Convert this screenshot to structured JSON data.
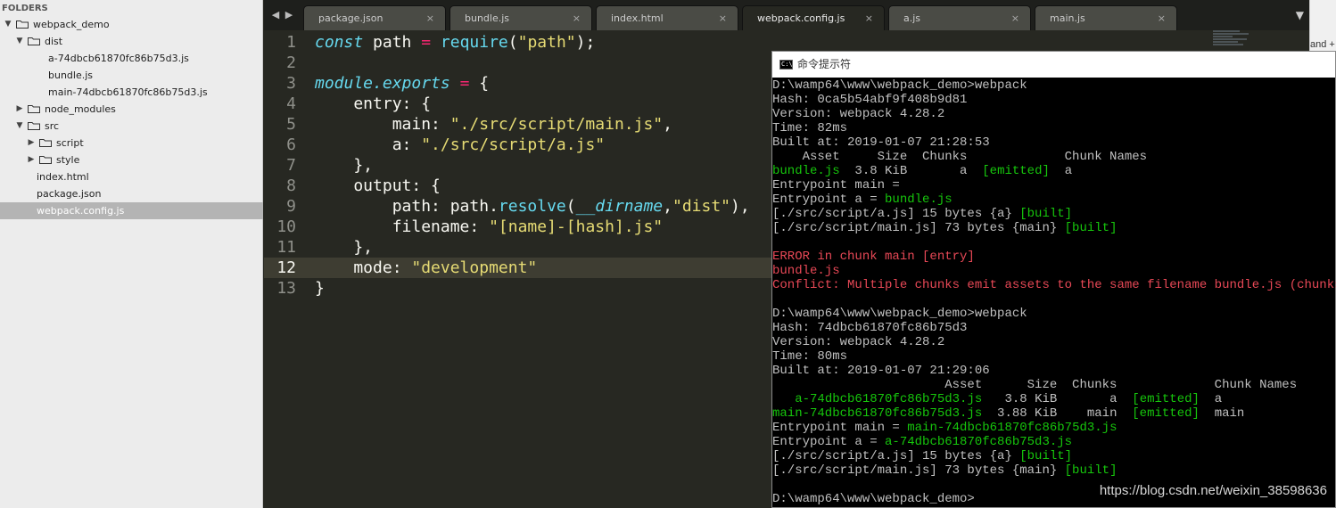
{
  "sidebar": {
    "header": "FOLDERS",
    "items": [
      {
        "label": "webpack_demo",
        "type": "folder",
        "arrow": "▼",
        "level": 0,
        "name": "tree-folder-webpack-demo"
      },
      {
        "label": "dist",
        "type": "folder",
        "arrow": "▼",
        "level": 1,
        "name": "tree-folder-dist"
      },
      {
        "label": "a-74dbcb61870fc86b75d3.js",
        "type": "file",
        "level": 3,
        "name": "tree-file-a-hash"
      },
      {
        "label": "bundle.js",
        "type": "file",
        "level": 3,
        "name": "tree-file-bundle"
      },
      {
        "label": "main-74dbcb61870fc86b75d3.js",
        "type": "file",
        "level": 3,
        "name": "tree-file-main-hash"
      },
      {
        "label": "node_modules",
        "type": "folder",
        "arrow": "▶",
        "level": 1,
        "name": "tree-folder-node-modules"
      },
      {
        "label": "src",
        "type": "folder",
        "arrow": "▼",
        "level": 1,
        "name": "tree-folder-src"
      },
      {
        "label": "script",
        "type": "folder",
        "arrow": "▶",
        "level": 2,
        "name": "tree-folder-script"
      },
      {
        "label": "style",
        "type": "folder",
        "arrow": "▶",
        "level": 2,
        "name": "tree-folder-style"
      },
      {
        "label": "index.html",
        "type": "file",
        "level": 2,
        "name": "tree-file-index-html"
      },
      {
        "label": "package.json",
        "type": "file",
        "level": 2,
        "name": "tree-file-package-json"
      },
      {
        "label": "webpack.config.js",
        "type": "file",
        "level": 2,
        "selected": true,
        "name": "tree-file-webpack-config"
      }
    ]
  },
  "tabs": [
    {
      "label": "package.json",
      "active": false
    },
    {
      "label": "bundle.js",
      "active": false
    },
    {
      "label": "index.html",
      "active": false
    },
    {
      "label": "webpack.config.js",
      "active": true
    },
    {
      "label": "a.js",
      "active": false
    },
    {
      "label": "main.js",
      "active": false
    }
  ],
  "tab_close_glyph": "×",
  "nav": {
    "prev": "◀",
    "next": "▶",
    "dropdown": "▼"
  },
  "editor": {
    "current_line": 12,
    "lines": [
      [
        [
          "kw",
          "const"
        ],
        [
          "t",
          " path "
        ],
        [
          "op",
          "="
        ],
        [
          "t",
          " "
        ],
        [
          "fn",
          "require"
        ],
        [
          "t",
          "("
        ],
        [
          "str",
          "\"path\""
        ],
        [
          "t",
          ");"
        ]
      ],
      [],
      [
        [
          "it",
          "module"
        ],
        [
          "it",
          "."
        ],
        [
          "it",
          "exports"
        ],
        [
          "t",
          " "
        ],
        [
          "op",
          "="
        ],
        [
          "t",
          " {"
        ]
      ],
      [
        [
          "t",
          "    entry: {"
        ]
      ],
      [
        [
          "t",
          "        main: "
        ],
        [
          "str",
          "\"./src/script/main.js\""
        ],
        [
          "t",
          ","
        ]
      ],
      [
        [
          "t",
          "        a: "
        ],
        [
          "str",
          "\"./src/script/a.js\""
        ]
      ],
      [
        [
          "t",
          "    },"
        ]
      ],
      [
        [
          "t",
          "    output: {"
        ]
      ],
      [
        [
          "t",
          "        path: path."
        ],
        [
          "fn",
          "resolve"
        ],
        [
          "t",
          "("
        ],
        [
          "it",
          "__dirname"
        ],
        [
          "t",
          ","
        ],
        [
          "str",
          "\"dist\""
        ],
        [
          "t",
          "),"
        ]
      ],
      [
        [
          "t",
          "        filename: "
        ],
        [
          "str",
          "\"[name]-[hash].js\""
        ]
      ],
      [
        [
          "t",
          "    },"
        ]
      ],
      [
        [
          "t",
          "    mode: "
        ],
        [
          "str",
          "\"development\""
        ]
      ],
      [
        [
          "t",
          "}"
        ]
      ]
    ]
  },
  "right_sliver_text": "and +",
  "cmd": {
    "title": "命令提示符",
    "icon_text": "C:\\",
    "lines": [
      [
        [
          "w",
          "D:\\wamp64\\www\\webpack_demo>webpack"
        ]
      ],
      [
        [
          "w",
          "Hash: 0ca5b54abf9f408b9d81"
        ]
      ],
      [
        [
          "w",
          "Version: webpack 4.28.2"
        ]
      ],
      [
        [
          "w",
          "Time: 82ms"
        ]
      ],
      [
        [
          "w",
          "Built at: 2019-01-07 21:28:53"
        ]
      ],
      [
        [
          "w",
          "    Asset     Size  Chunks             Chunk Names"
        ]
      ],
      [
        [
          "g",
          "bundle.js"
        ],
        [
          "w",
          "  3.8 KiB       a  "
        ],
        [
          "g",
          "[emitted]"
        ],
        [
          "w",
          "  a"
        ]
      ],
      [
        [
          "w",
          "Entrypoint main ="
        ]
      ],
      [
        [
          "w",
          "Entrypoint a = "
        ],
        [
          "g",
          "bundle.js"
        ]
      ],
      [
        [
          "w",
          "[./src/script/a.js] 15 bytes {a} "
        ],
        [
          "g",
          "[built]"
        ]
      ],
      [
        [
          "w",
          "[./src/script/main.js] 73 bytes {main} "
        ],
        [
          "g",
          "[built]"
        ]
      ],
      [],
      [
        [
          "r",
          "ERROR in chunk main [entry]"
        ]
      ],
      [
        [
          "r",
          "bundle.js"
        ]
      ],
      [
        [
          "r",
          "Conflict: Multiple chunks emit assets to the same filename bundle.js (chunks a"
        ]
      ],
      [],
      [
        [
          "w",
          "D:\\wamp64\\www\\webpack_demo>webpack"
        ]
      ],
      [
        [
          "w",
          "Hash: 74dbcb61870fc86b75d3"
        ]
      ],
      [
        [
          "w",
          "Version: webpack 4.28.2"
        ]
      ],
      [
        [
          "w",
          "Time: 80ms"
        ]
      ],
      [
        [
          "w",
          "Built at: 2019-01-07 21:29:06"
        ]
      ],
      [
        [
          "w",
          "                       Asset      Size  Chunks             Chunk Names"
        ]
      ],
      [
        [
          "w",
          "   "
        ],
        [
          "g",
          "a-74dbcb61870fc86b75d3.js"
        ],
        [
          "w",
          "   3.8 KiB       a  "
        ],
        [
          "g",
          "[emitted]"
        ],
        [
          "w",
          "  a"
        ]
      ],
      [
        [
          "g",
          "main-74dbcb61870fc86b75d3.js"
        ],
        [
          "w",
          "  3.88 KiB    main  "
        ],
        [
          "g",
          "[emitted]"
        ],
        [
          "w",
          "  main"
        ]
      ],
      [
        [
          "w",
          "Entrypoint main = "
        ],
        [
          "g",
          "main-74dbcb61870fc86b75d3.js"
        ]
      ],
      [
        [
          "w",
          "Entrypoint a = "
        ],
        [
          "g",
          "a-74dbcb61870fc86b75d3.js"
        ]
      ],
      [
        [
          "w",
          "[./src/script/a.js] 15 bytes {a} "
        ],
        [
          "g",
          "[built]"
        ]
      ],
      [
        [
          "w",
          "[./src/script/main.js] 73 bytes {main} "
        ],
        [
          "g",
          "[built]"
        ]
      ],
      [],
      [
        [
          "w",
          "D:\\wamp64\\www\\webpack_demo>"
        ]
      ]
    ]
  },
  "watermark": "https://blog.csdn.net/weixin_38598636"
}
